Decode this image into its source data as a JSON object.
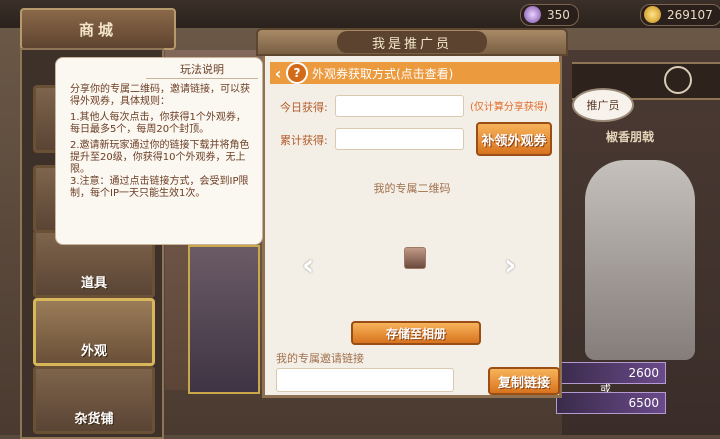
{
  "shop": {
    "title": "商城"
  },
  "currency": {
    "gems": "350",
    "coins": "269107"
  },
  "sidebar": {
    "items": [
      {
        "label": "道具"
      },
      {
        "label": "外观"
      },
      {
        "label": "杂货铺"
      }
    ]
  },
  "character": {
    "name": "椒香朋戟"
  },
  "promoter_tag": "推广员",
  "prices": {
    "first": "2600",
    "or": "或",
    "second": "6500"
  },
  "modal": {
    "title": "我是推广员",
    "coupon_bar": "外观券获取方式(点击查看)",
    "today_label": "今日获得:",
    "total_label": "累计获得:",
    "note": "(仅计算分享获得)",
    "redeem_button": "补领外观券",
    "qr_caption": "我的专属二维码",
    "save_button": "存储至相册",
    "link_caption": "我的专属邀请链接",
    "copy_button": "复制链接"
  },
  "rules": {
    "title": "玩法说明",
    "p1": "分享你的专属二维码，邀请链接，可以获得外观券，具体规则：",
    "p2": "1.其他人每次点击，你获得1个外观券，每日最多5个，每周20个封顶。",
    "p3": "2.邀请新玩家通过你的链接下载并将角色提升至20级，你获得10个外观券，无上限。\n3.注意：通过点击链接方式，会受到IP限制，每个IP一天只能生效1次。"
  },
  "colors": {
    "accent": "#ec9a3e",
    "button": "#d8731e",
    "panel": "#f4efe6",
    "frame": "#8d7151"
  },
  "icons": [
    "question-icon",
    "back-chevron-icon",
    "left-arrow-icon",
    "right-arrow-icon",
    "gem-icon",
    "coin-icon",
    "pointing-hand-icon"
  ]
}
